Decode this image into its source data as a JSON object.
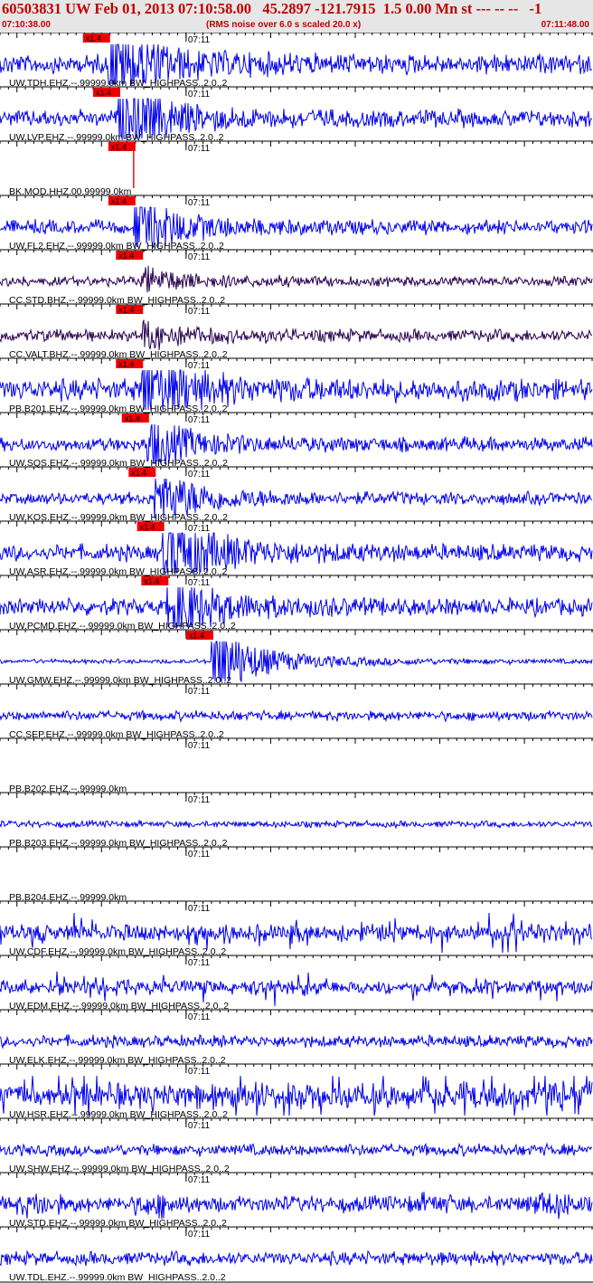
{
  "header": {
    "title": "60503831 UW Feb 01, 2013 07:10:58.00   45.2897 -121.7915  1.5 0.00 Mn st --- -- --   -1",
    "start_time": "07:10:38.00",
    "noise_note": "(RMS noise over 6.0 s scaled 20.0 x)",
    "end_time": "07:11:48.00"
  },
  "colors": {
    "trace": "#0000ee",
    "trace_dark": "#2a0050",
    "pick_box": "#ee0000",
    "title": "#c00000",
    "axis": "#000000",
    "header_bg": "#e6e6e6"
  },
  "chart_data": {
    "type": "line",
    "x_unit": "time",
    "x_range": [
      "07:10:38.00",
      "07:11:48.00"
    ],
    "minute_tick_label": "07:11",
    "pick_label": "x1.4",
    "series": [
      {
        "name": "UW.TDH.EHZ.--.99999.0km BW_HIGHPASS..2.0..2",
        "pick": "07:10:50.8",
        "amp": 0.35,
        "burst": 1.8,
        "dark": false
      },
      {
        "name": "UW.LVP.EHZ.--.99999.0km BW_HIGHPASS..2.0..2",
        "pick": "07:10:52.0",
        "amp": 0.3,
        "burst": 1.6,
        "dark": false
      },
      {
        "name": "BK.MOD.HHZ.00.99999.0km",
        "pick": "07:10:53.8",
        "amp": 0.0,
        "burst": 0.0,
        "dark": false,
        "spike": true
      },
      {
        "name": "UW.FL2.EHZ.--.99999.0km BW_HIGHPASS..2.0..2",
        "pick": "07:10:53.8",
        "amp": 0.25,
        "burst": 1.2,
        "dark": false
      },
      {
        "name": "CC.STD.BHZ.--.99999.0km BW_HIGHPASS..2.0..2",
        "pick": "07:10:54.7",
        "amp": 0.18,
        "burst": 0.5,
        "dark": true
      },
      {
        "name": "CC.VALT.BHZ.--.99999.0km BW_HIGHPASS..2.0..2",
        "pick": "07:10:54.7",
        "amp": 0.22,
        "burst": 0.5,
        "dark": true
      },
      {
        "name": "PB.B201.EHZ.--.99999.0km BW_HIGHPASS..2.0..2",
        "pick": "07:10:54.7",
        "amp": 0.4,
        "burst": 1.5,
        "dark": false
      },
      {
        "name": "UW.SQS.EHZ.--.99999.0km BW_HIGHPASS..2.0..2",
        "pick": "07:10:55.4",
        "amp": 0.25,
        "burst": 1.0,
        "dark": false
      },
      {
        "name": "UW.KOS.EHZ.--.99999.0km BW_HIGHPASS..2.0..2",
        "pick": "07:10:56.2",
        "amp": 0.22,
        "burst": 1.2,
        "dark": false
      },
      {
        "name": "UW.ASR.EHZ.--.99999.0km BW_HIGHPASS..2.0..2",
        "pick": "07:10:57.2",
        "amp": 0.3,
        "burst": 1.8,
        "dark": false
      },
      {
        "name": "UW.PCMD.EHZ.--.99999.0km BW_HIGHPASS..2.0..2",
        "pick": "07:10:57.7",
        "amp": 0.3,
        "burst": 1.4,
        "dark": false
      },
      {
        "name": "UW.GMW.EHZ.--.99999.0km BW_HIGHPASS..2.0..2",
        "pick": "07:11:03.0",
        "amp": 0.08,
        "burst": 1.6,
        "dark": false
      },
      {
        "name": "CC.SEP.EHZ.--.99999.0km BW_HIGHPASS..2.0..2",
        "pick": null,
        "amp": 0.18,
        "burst": 0.0,
        "dark": false
      },
      {
        "name": "PB.B202.EHZ.--.99999.0km",
        "pick": null,
        "amp": 0.0,
        "burst": 0.0,
        "dark": false
      },
      {
        "name": "PB.B203.EHZ.--.99999.0km BW_HIGHPASS..2.0..2",
        "pick": null,
        "amp": 0.12,
        "burst": 1.0,
        "dark": false
      },
      {
        "name": "PB.B204.EHZ.--.99999.0km",
        "pick": null,
        "amp": 0.0,
        "burst": 0.0,
        "dark": false
      },
      {
        "name": "UW.CDF.EHZ.--.99999.0km BW_HIGHPASS..2.0..2",
        "pick": null,
        "amp": 0.3,
        "burst": 0.0,
        "dark": false,
        "spiky": true
      },
      {
        "name": "UW.EDM.EHZ.--.99999.0km BW_HIGHPASS..2.0..2",
        "pick": null,
        "amp": 0.25,
        "burst": 0.0,
        "dark": false,
        "spiky": true
      },
      {
        "name": "UW.ELK.EHZ.--.99999.0km BW_HIGHPASS..2.0..2",
        "pick": null,
        "amp": 0.22,
        "burst": 0.0,
        "dark": false
      },
      {
        "name": "UW.HSR.EHZ.--.99999.0km BW_HIGHPASS..2.0..2",
        "pick": null,
        "amp": 0.45,
        "burst": 0.0,
        "dark": false,
        "spiky": true
      },
      {
        "name": "UW.SHW.EHZ.--.99999.0km BW_HIGHPASS..2.0..2",
        "pick": null,
        "amp": 0.22,
        "burst": 0.0,
        "dark": false
      },
      {
        "name": "UW.STD.EHZ.--.99999.0km BW_HIGHPASS..2.0..2",
        "pick": null,
        "amp": 0.3,
        "burst": 0.0,
        "dark": false,
        "bumpy": true
      },
      {
        "name": "UW.TDL.EHZ.--.99999.0km BW_HIGHPASS..2.0..2",
        "pick": null,
        "amp": 0.25,
        "burst": 0.0,
        "dark": false
      }
    ]
  }
}
